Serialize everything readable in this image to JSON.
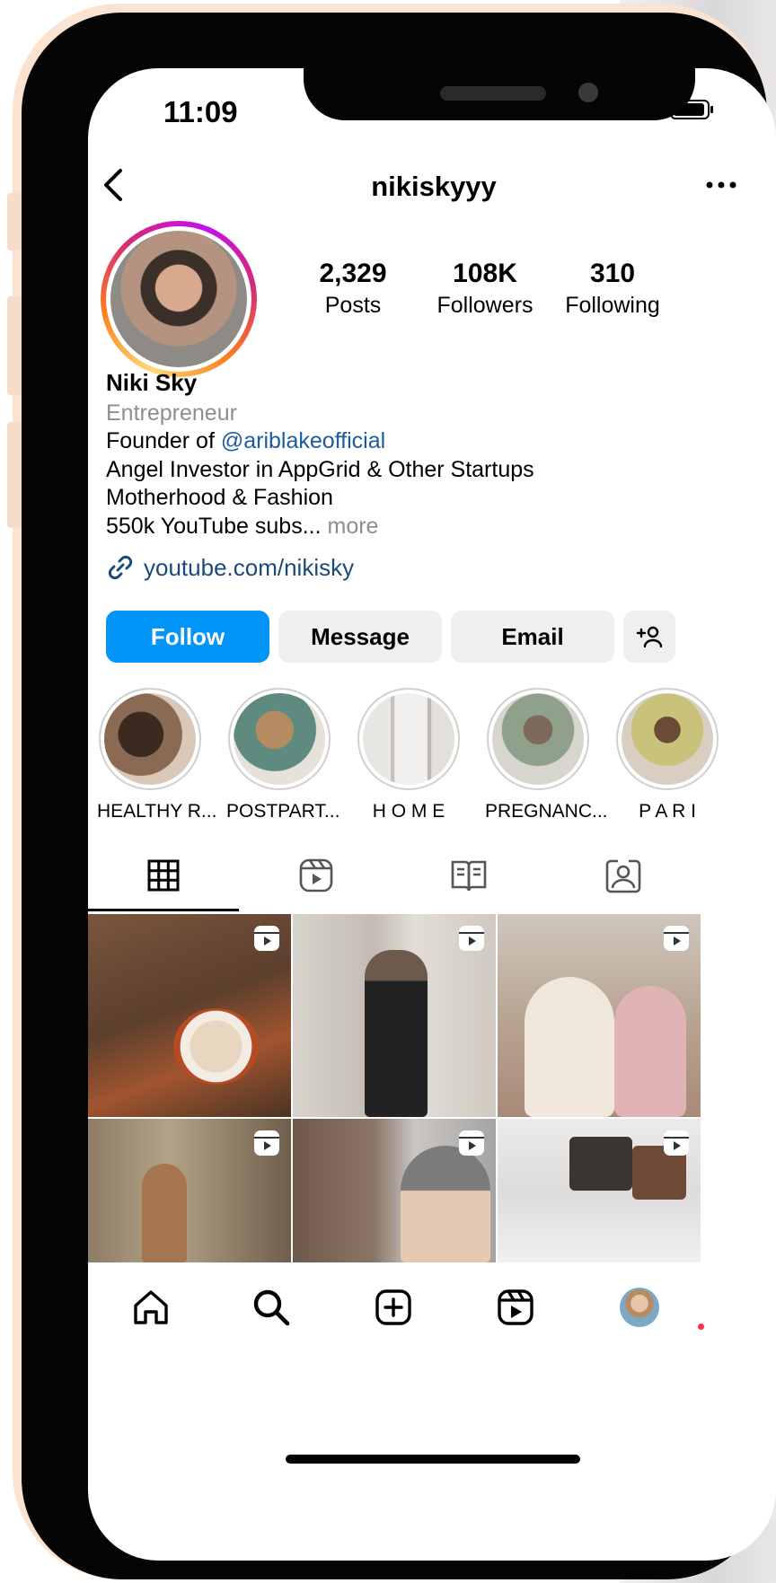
{
  "status_bar": {
    "time": "11:09"
  },
  "header": {
    "username": "nikiskyyy"
  },
  "stats": [
    {
      "value": "2,329",
      "label": "Posts"
    },
    {
      "value": "108K",
      "label": "Followers"
    },
    {
      "value": "310",
      "label": "Following"
    }
  ],
  "bio": {
    "name": "Niki Sky",
    "category": "Entrepreneur",
    "line1_prefix": "Founder of ",
    "line1_mention": "@ariblakeofficial",
    "line2": "Angel Investor in AppGrid & Other Startups",
    "line3": "Motherhood & Fashion",
    "line4": "550k YouTube subs...",
    "more": "more",
    "link": "youtube.com/nikisky"
  },
  "actions": {
    "follow": "Follow",
    "message": "Message",
    "email": "Email",
    "add_user": "+&"
  },
  "highlights": [
    {
      "label": "HEALTHY R...",
      "color": "#5a4030"
    },
    {
      "label": "POSTPART...",
      "color": "#6b8a7a"
    },
    {
      "label": "H O M E",
      "color": "#c9c6c2"
    },
    {
      "label": "PREGNANC...",
      "color": "#b7b1a6"
    },
    {
      "label": "P A R I",
      "color": "#c8b9a0"
    }
  ],
  "tabs": [
    "grid",
    "reels",
    "guides",
    "tagged"
  ],
  "grid_colors": [
    [
      "#6b4a36",
      "#c9c3bd",
      "#b39d8e"
    ],
    [
      "#8c7a63",
      "#7a736c",
      "#d7d4cf"
    ]
  ],
  "colors": {
    "accent": "#0095f6",
    "mention": "#1a5c9e",
    "muted": "#8e8e8e"
  }
}
